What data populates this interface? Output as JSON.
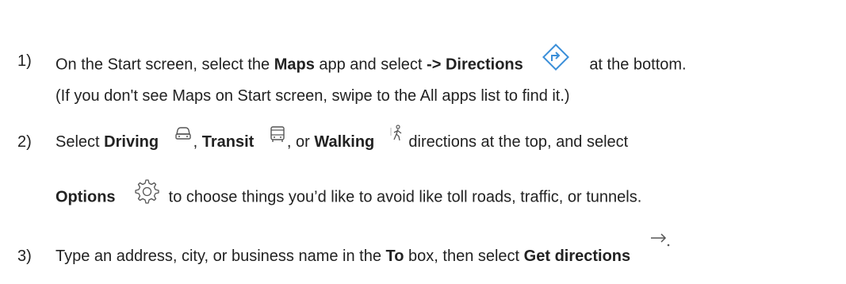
{
  "steps": [
    {
      "number": "1)",
      "line1": {
        "t1": "On the Start screen, select the ",
        "b1": "Maps",
        "t2": " app and select ",
        "b2": "-> Directions",
        "t3": "at the bottom."
      },
      "line2": "(If you don't see Maps on Start screen, swipe to the All apps list to find it.)"
    },
    {
      "number": "2)",
      "line1": {
        "t1": "Select ",
        "b1": "Driving",
        "t2": ", ",
        "b2": "Transit",
        "t3": ", or ",
        "b3": "Walking",
        "t4": " directions at the top, and select"
      },
      "line2": {
        "b1": "Options",
        "t1": " to choose things you’d like to avoid like toll roads, traffic, or tunnels."
      }
    },
    {
      "number": "3)",
      "line1": {
        "t1": "Type an address, city, or business name in the ",
        "b1": "To",
        "t2": " box, then select ",
        "b2": "Get directions"
      }
    }
  ],
  "icons": {
    "directions": "directions-diamond-icon",
    "driving": "car-icon",
    "transit": "bus-icon",
    "walking": "walking-person-icon",
    "options": "gear-icon",
    "get_directions": "arrow-right-icon"
  },
  "colors": {
    "text": "#222222",
    "icon_blue": "#3b8fd9",
    "icon_gray": "#555555"
  }
}
